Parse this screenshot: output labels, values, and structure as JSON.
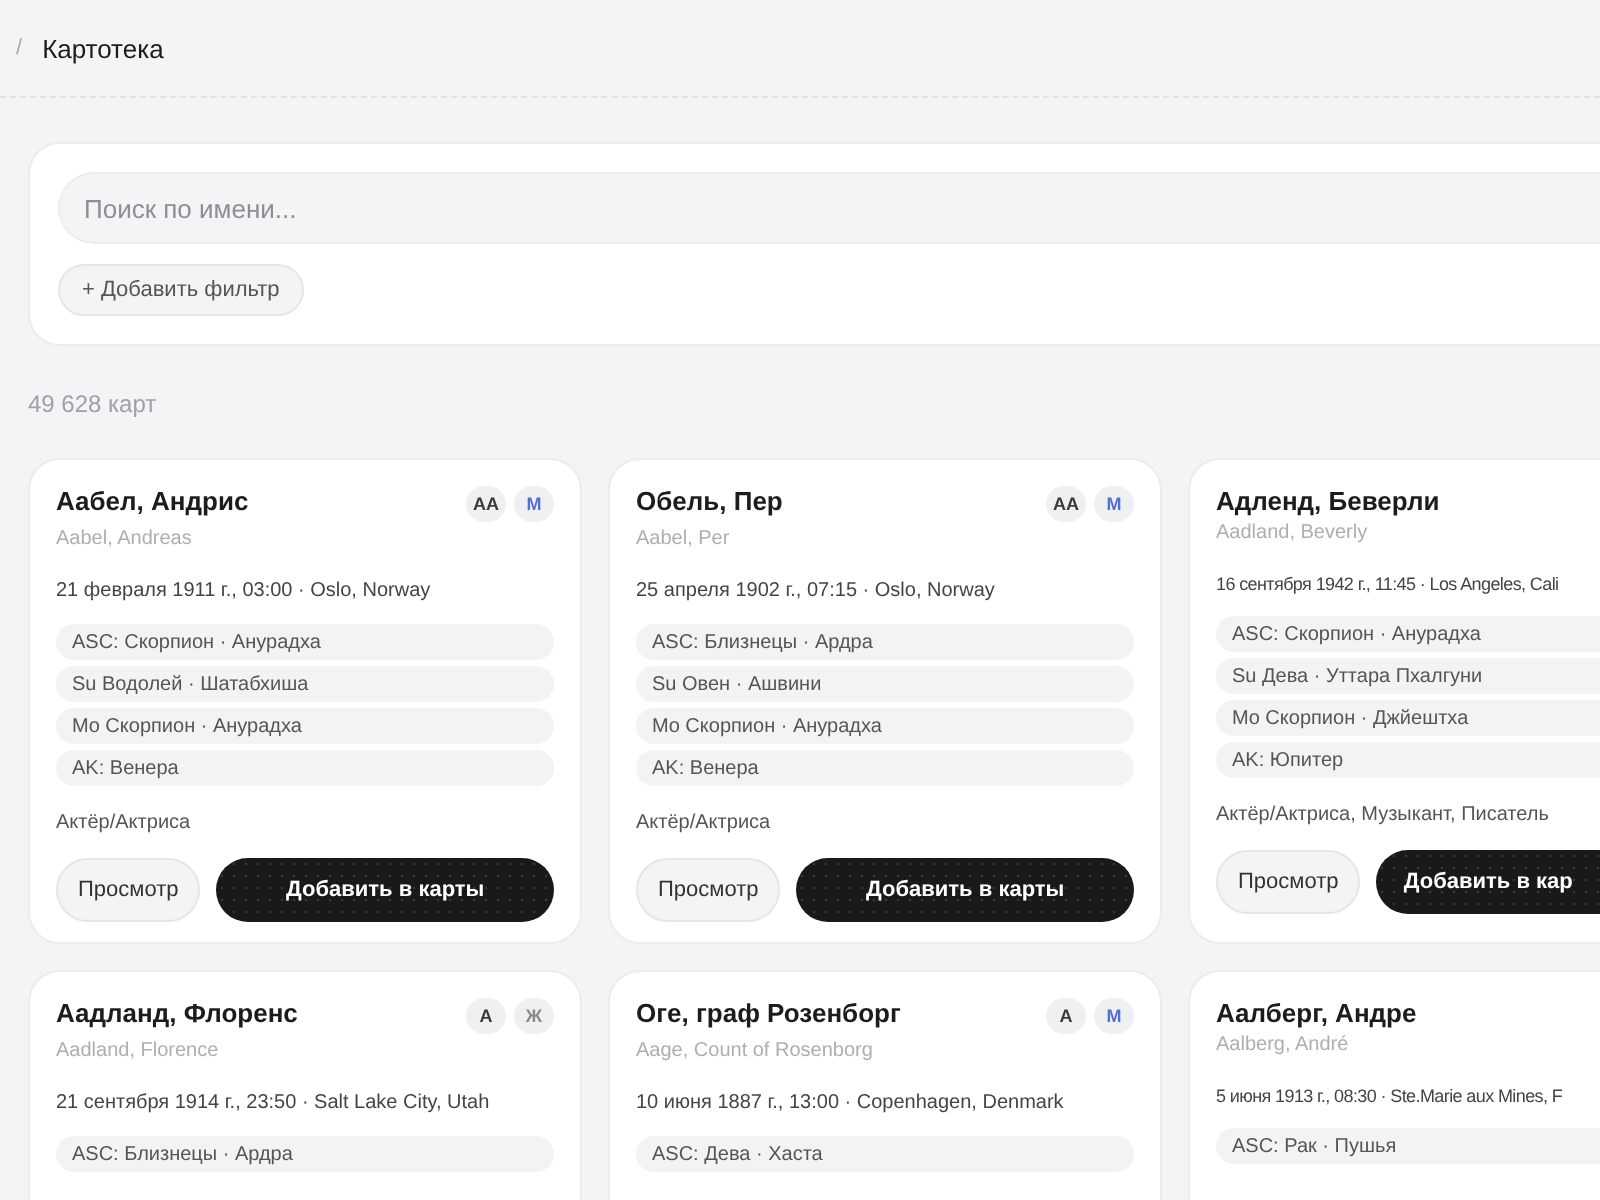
{
  "breadcrumb": {
    "separator": "/",
    "title": "Картотека"
  },
  "search": {
    "placeholder": "Поиск по имени..."
  },
  "filter_button": "+ Добавить фильтр",
  "count": "49 628 карт",
  "cards": [
    {
      "name": "Аабел, Андрис",
      "latin": "Aabel, Andreas",
      "birth": "21 февраля 1911 г., 03:00 · Oslo, Norway",
      "badges": [
        {
          "text": "AA",
          "color": "#3a3a3a"
        },
        {
          "text": "M",
          "color": "#4f6fd8"
        }
      ],
      "pills": [
        "ASC: Скорпион · Анурадха",
        "Su Водолей · Шатабхиша",
        "Mo Скорпион · Анурадха",
        "AK: Венера"
      ],
      "professions": "Актёр/Актриса",
      "view_button": "Просмотр",
      "add_button": "Добавить в карты"
    },
    {
      "name": "Обель, Пер",
      "latin": "Aabel, Per",
      "birth": "25 апреля 1902 г., 07:15 · Oslo, Norway",
      "badges": [
        {
          "text": "AA",
          "color": "#3a3a3a"
        },
        {
          "text": "M",
          "color": "#4f6fd8"
        }
      ],
      "pills": [
        "ASC: Близнецы · Ардра",
        "Su Овен · Ашвини",
        "Mo Скорпион · Анурадха",
        "AK: Венера"
      ],
      "professions": "Актёр/Актриса",
      "view_button": "Просмотр",
      "add_button": "Добавить в карты"
    },
    {
      "name": "Адленд, Беверли",
      "latin": "Aadland, Beverly",
      "birth": "16 сентября 1942 г., 11:45 · Los Angeles, Cali",
      "pills": [
        "ASC: Скорпион · Анурадха",
        "Su Дева · Уттара Пхалгуни",
        "Mo Скорпион · Джйештха",
        "AK: Юпитер"
      ],
      "professions": "Актёр/Актриса, Музыкант, Писатель",
      "view_button": "Просмотр",
      "add_button": "Добавить в кар"
    },
    {
      "name": "Аадланд, Флоренс",
      "latin": "Aadland, Florence",
      "birth": "21 сентября 1914 г., 23:50 · Salt Lake City, Utah",
      "badges": [
        {
          "text": "A",
          "color": "#3a3a3a"
        },
        {
          "text": "Ж",
          "color": "#8a8a8a"
        }
      ],
      "pills": [
        "ASC: Близнецы · Ардра"
      ]
    },
    {
      "name": "Оге, граф Розенборг",
      "latin": "Aage, Count of Rosenborg",
      "birth": "10 июня 1887 г., 13:00 · Copenhagen, Denmark",
      "badges": [
        {
          "text": "A",
          "color": "#3a3a3a"
        },
        {
          "text": "M",
          "color": "#4f6fd8"
        }
      ],
      "pills": [
        "ASC: Дева · Хаста"
      ]
    },
    {
      "name": "Аалберг, Андре",
      "latin": "Aalberg, André",
      "birth": "5 июня 1913 г., 08:30 · Ste.Marie aux Mines, F",
      "pills": [
        "ASC: Рак · Пушья"
      ]
    }
  ]
}
